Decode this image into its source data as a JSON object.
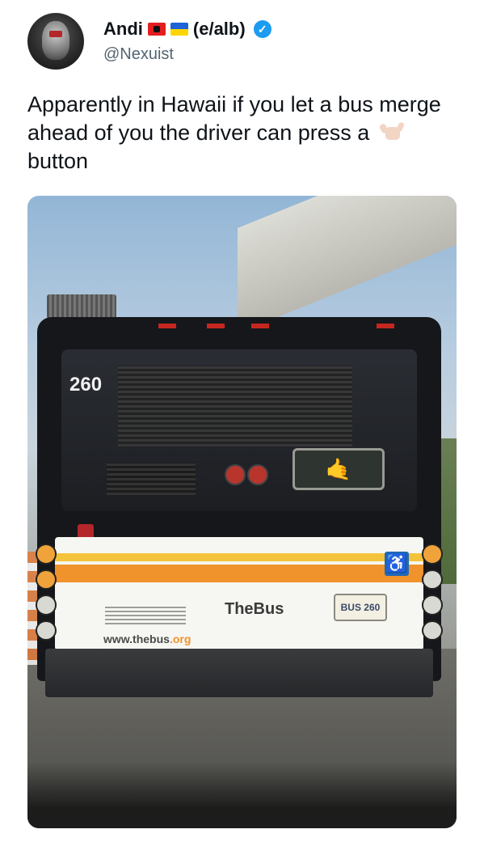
{
  "author": {
    "name": "Andi",
    "tag": "(e/alb)",
    "handle": "@Nexuist",
    "flags": [
      "albania-flag",
      "ukraine-flag"
    ],
    "verified": true
  },
  "tweet": {
    "text_before_emoji": "Apparently in Hawaii if you let a bus merge ahead of you the driver can press a",
    "emoji": "shaka-hand-emoji",
    "text_after_emoji": "button"
  },
  "photo": {
    "bus_route_number": "260",
    "brand_logo": "TheBus",
    "plate_text": "BUS 260",
    "website_main": "www.thebus",
    "website_tld": ".org",
    "rear_sign_symbol": "🤙",
    "accessibility_symbol": "♿"
  },
  "colors": {
    "verified_badge": "#1d9bf0",
    "handle_text": "#536471",
    "bus_orange": "#f0932c",
    "bus_yellow": "#f3c43b"
  }
}
